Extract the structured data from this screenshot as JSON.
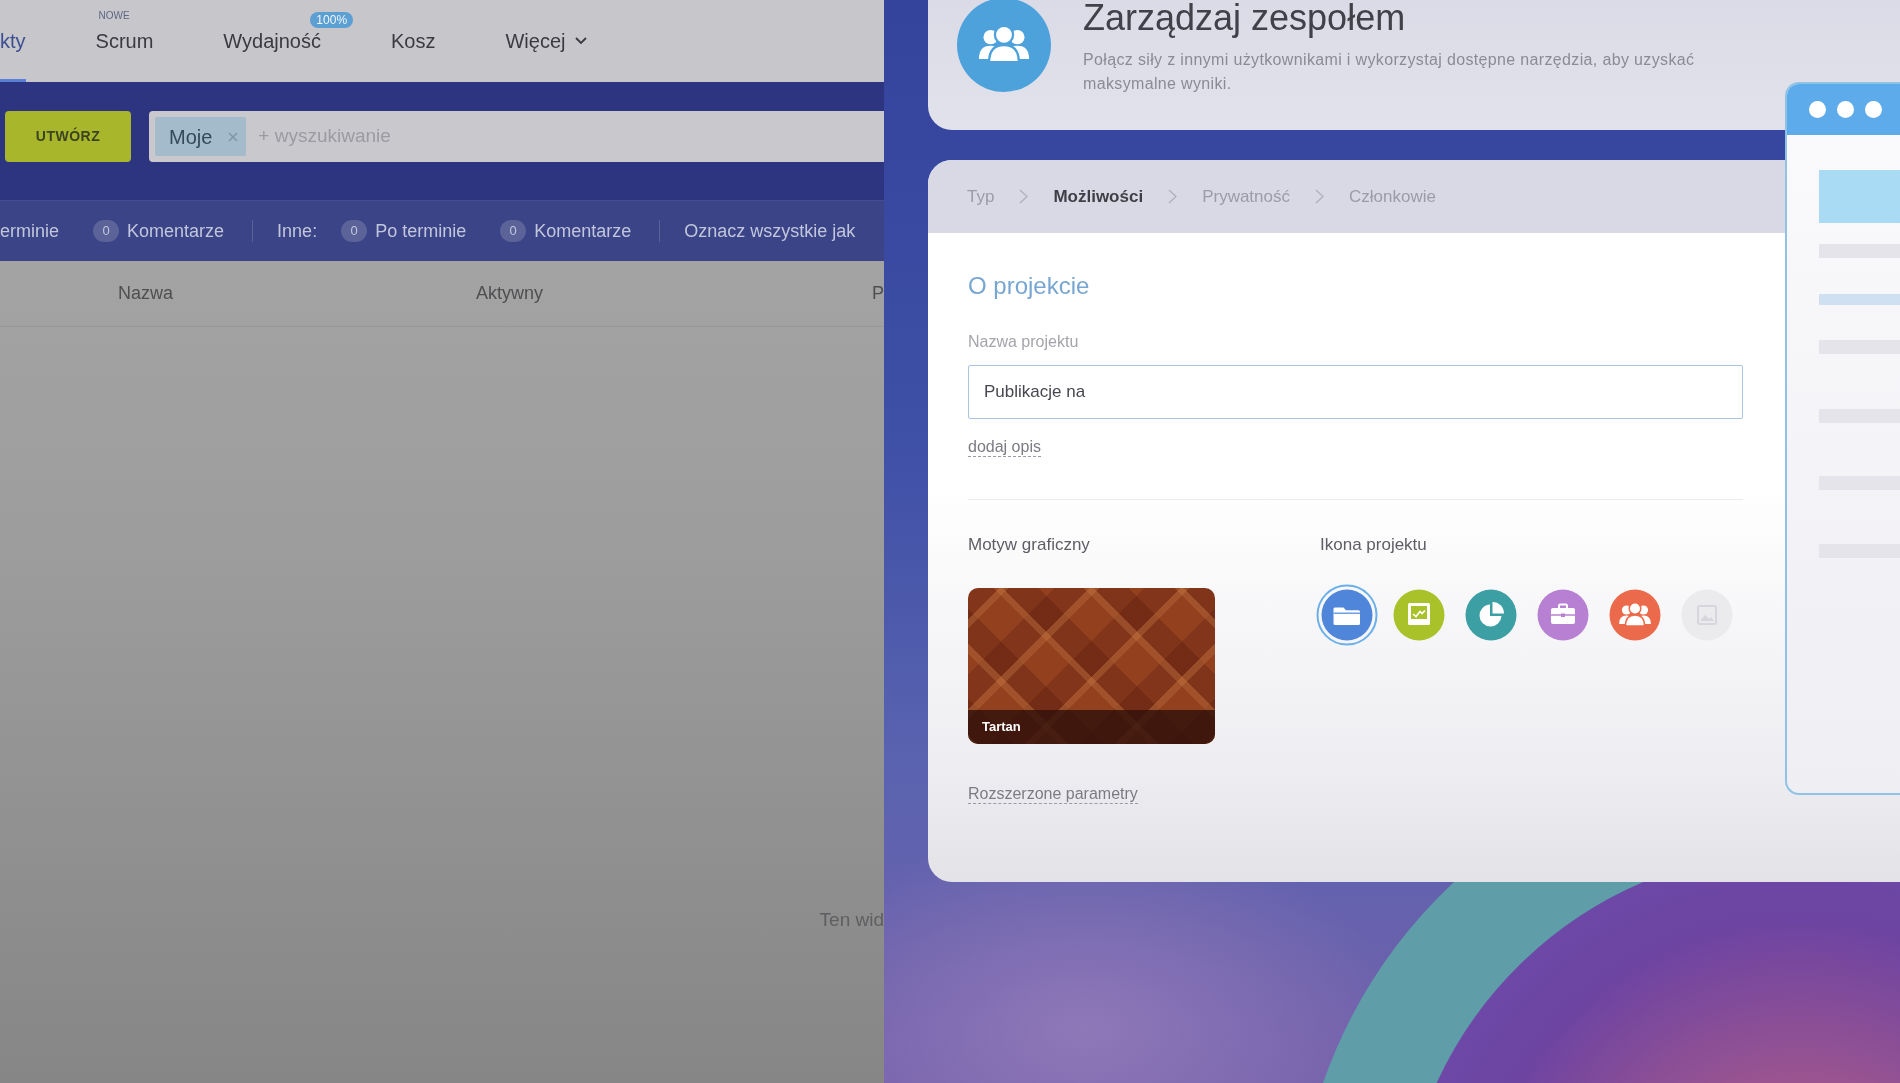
{
  "app": {
    "tabs": [
      {
        "label": "kty",
        "selected": true
      },
      {
        "label": "Scrum",
        "selected": false,
        "tag": "NOWE"
      },
      {
        "label": "Wydajność",
        "selected": false,
        "badge": "100%"
      },
      {
        "label": "Kosz",
        "selected": false
      },
      {
        "label": "Więcej",
        "selected": false,
        "dropdown": true
      }
    ],
    "create_button": "UTWÓRZ",
    "search": {
      "chips": [
        "Moje"
      ],
      "placeholder": "+ wyszukiwanie"
    },
    "counter_groups": [
      {
        "items": [
          {
            "label": "erminie"
          },
          {
            "count": "0",
            "label": "Komentarze"
          }
        ]
      },
      {
        "heading": "Inne:",
        "items": [
          {
            "count": "0",
            "label": "Po terminie"
          },
          {
            "count": "0",
            "label": "Komentarze"
          }
        ]
      },
      {
        "items": [
          {
            "label": "Oznacz wszystkie jak"
          }
        ]
      }
    ],
    "table": {
      "columns": [
        "Nazwa",
        "Aktywny",
        "P"
      ],
      "empty_text": "Ten wid"
    }
  },
  "panel": {
    "header": {
      "title": "Zarządzaj zespołem",
      "description": "Połącz siły z innymi użytkownikami i wykorzystaj dostępne narzędzia, aby uzyskać maksymalne wyniki."
    },
    "steps": [
      {
        "label": "Typ",
        "selected": false
      },
      {
        "label": "Możliwości",
        "selected": true
      },
      {
        "label": "Prywatność",
        "selected": false
      },
      {
        "label": "Członkowie",
        "selected": false
      }
    ],
    "section_title": "O projekcie",
    "name_field": {
      "label": "Nazwa projektu",
      "value": "Publikacje na"
    },
    "add_description_link": "dodaj opis",
    "theme": {
      "label": "Motyw graficzny",
      "name": "Tartan"
    },
    "icon_picker": {
      "label": "Ikona projektu",
      "icons": [
        {
          "kind": "folder",
          "color": "#4f86d9",
          "selected": true
        },
        {
          "kind": "board",
          "color": "#a9c22a",
          "selected": false
        },
        {
          "kind": "pie",
          "color": "#3b9fa3",
          "selected": false
        },
        {
          "kind": "briefcase",
          "color": "#b880d2",
          "selected": false
        },
        {
          "kind": "team",
          "color": "#ec6a4c",
          "selected": false
        },
        {
          "kind": "image",
          "color": "#ebebee",
          "selected": false
        }
      ]
    },
    "advanced_link": "Rozszerzone parametry"
  }
}
